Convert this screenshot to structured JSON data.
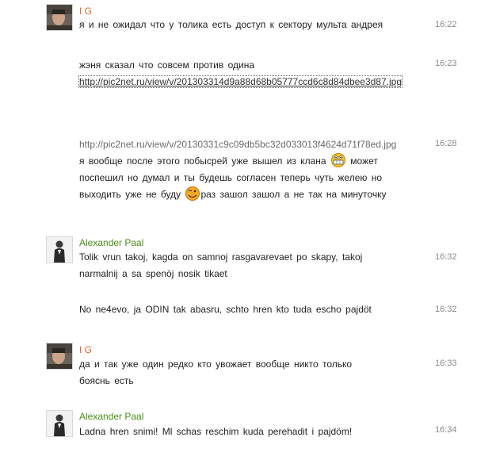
{
  "messages": [
    {
      "author": "I G",
      "text": "я и не ожидал что у толика есть доступ к сектору мульта андрея",
      "time": "16:22"
    },
    {
      "text_before": "жэня сказал что совсем против одина",
      "link": "http://pic2net.ru/view/v/201303314d9a88d68b05777ccd6c8d84dbee3d87.jpg",
      "time": "16:23"
    },
    {
      "link": "http://pic2net.ru/view/v/20130331c9c09db5bc32d033013f4624d71f78ed.jpg",
      "part1": "я вообще после этого побысрей уже вышел из клана",
      "part2": "может поспешил но думал и ты будешь согласен теперь чуть желею но выходить уже не буду",
      "part3": "раз зашол зашол а не так на минуточку",
      "smiley1": "grin-smiley-icon",
      "smiley2": "wink-smiley-icon",
      "time": "16:28"
    },
    {
      "author": "Alexander Paal",
      "text": "Tolik vrun takoj, kagda on samnoj rasgavarevaet po skapy, takoj narmalnij a sa spenöj nosik tikaet",
      "time": "16:32"
    },
    {
      "text": "No ne4evo, ja ODIN tak abasru, schto hren kto tuda escho pajdöt",
      "time": "16:32"
    },
    {
      "author": "I G",
      "text": "да и так уже один редко кто увожает вообще никто только бояснь есть",
      "time": "16:33"
    },
    {
      "author": "Alexander Paal",
      "text": "Ladna hren snimi! Ml schas reschim kuda perehadit i pajdöm!",
      "time": "16:34"
    }
  ],
  "colors": {
    "ig_name": "#e0622d",
    "paal_name": "#4a8f1a",
    "time": "#8a8a8a"
  }
}
